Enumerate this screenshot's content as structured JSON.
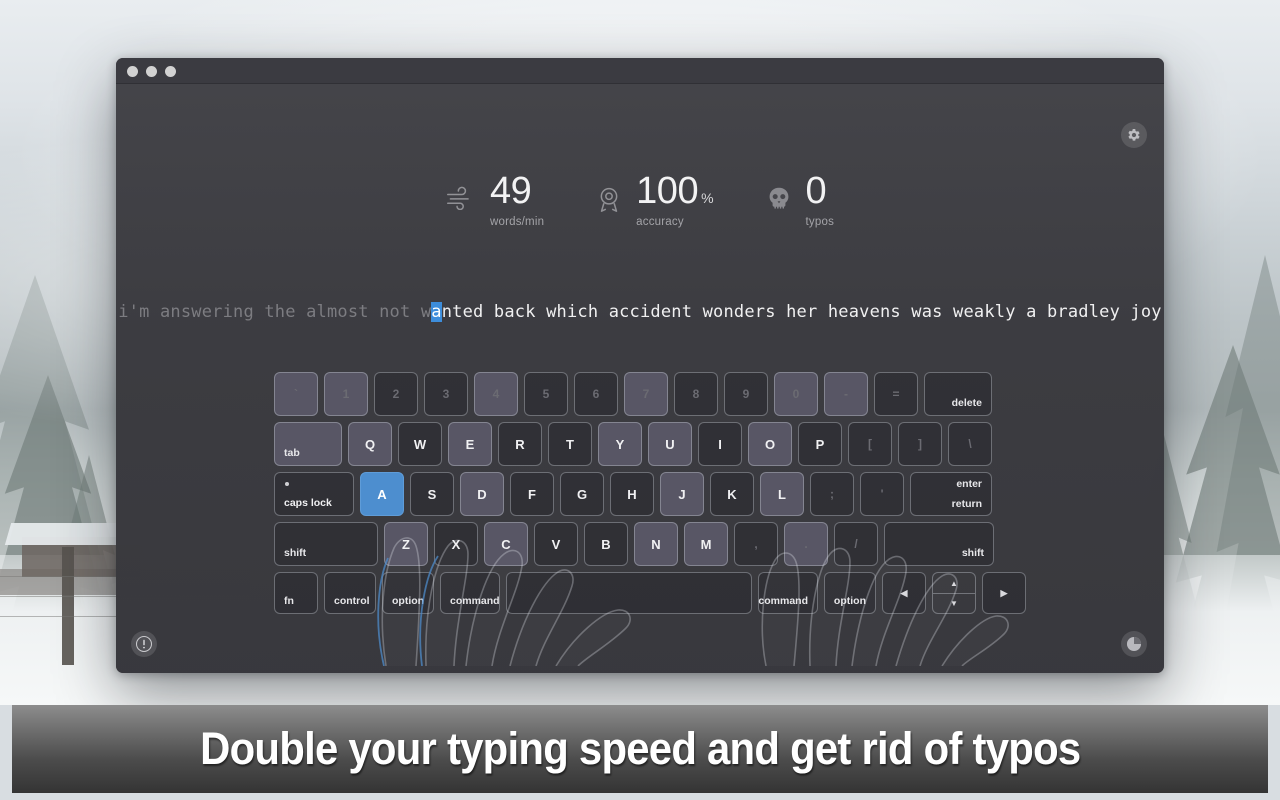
{
  "window": {
    "traffic_lights": [
      "close",
      "minimize",
      "zoom"
    ]
  },
  "icons": {
    "gear": "gear-icon",
    "info": "exclamation-circle-icon",
    "stats": "pie-chart-icon",
    "wind": "wind-icon",
    "medal": "medal-icon",
    "skull": "skull-icon"
  },
  "stats": [
    {
      "value": "49",
      "unit": "",
      "label": "words/min",
      "icon": "wind-icon"
    },
    {
      "value": "100",
      "unit": "%",
      "label": "accuracy",
      "icon": "medal-icon"
    },
    {
      "value": "0",
      "unit": "",
      "label": "typos",
      "icon": "skull-icon"
    }
  ],
  "typing": {
    "typed": "i'm answering the almost not w",
    "cursor": "a",
    "pending": "nted back which accident wonders her heavens was weakly a bradley joy",
    "full_text": "i'm answering the almost not wanted back which accident wonders her heavens was weakly a bradley joy",
    "cursor_color": "#3d8ddb"
  },
  "keyboard": {
    "active_key": "A",
    "rows": [
      {
        "name": "number-row",
        "keys": [
          {
            "label": "`",
            "style": "dim lit",
            "width": "w-mod"
          },
          {
            "label": "1",
            "style": "dim lit",
            "width": "w-mod"
          },
          {
            "label": "2",
            "style": "dim",
            "width": "w-mod"
          },
          {
            "label": "3",
            "style": "dim",
            "width": "w-mod"
          },
          {
            "label": "4",
            "style": "dim lit",
            "width": "w-mod"
          },
          {
            "label": "5",
            "style": "dim",
            "width": "w-mod"
          },
          {
            "label": "6",
            "style": "dim",
            "width": "w-mod"
          },
          {
            "label": "7",
            "style": "dim lit",
            "width": "w-mod"
          },
          {
            "label": "8",
            "style": "dim",
            "width": "w-mod"
          },
          {
            "label": "9",
            "style": "dim",
            "width": "w-mod"
          },
          {
            "label": "0",
            "style": "dim lit",
            "width": "w-mod"
          },
          {
            "label": "-",
            "style": "dim lit",
            "width": "w-mod"
          },
          {
            "label": "=",
            "style": "dim",
            "width": "w-mod"
          },
          {
            "label": "delete",
            "style": "lbl-br",
            "width": "w-del"
          }
        ]
      },
      {
        "name": "top-letter-row",
        "keys": [
          {
            "label": "tab",
            "style": "lbl-bl lit",
            "width": "w-tab"
          },
          {
            "label": "Q",
            "style": "lit",
            "width": "w-mod"
          },
          {
            "label": "W",
            "style": "",
            "width": "w-mod"
          },
          {
            "label": "E",
            "style": "lit",
            "width": "w-mod"
          },
          {
            "label": "R",
            "style": "",
            "width": "w-mod"
          },
          {
            "label": "T",
            "style": "",
            "width": "w-mod"
          },
          {
            "label": "Y",
            "style": "lit",
            "width": "w-mod"
          },
          {
            "label": "U",
            "style": "lit",
            "width": "w-mod"
          },
          {
            "label": "I",
            "style": "",
            "width": "w-mod"
          },
          {
            "label": "O",
            "style": "lit",
            "width": "w-mod"
          },
          {
            "label": "P",
            "style": "",
            "width": "w-mod"
          },
          {
            "label": "[",
            "style": "dim",
            "width": "w-mod"
          },
          {
            "label": "]",
            "style": "dim",
            "width": "w-mod"
          },
          {
            "label": "\\",
            "style": "dim",
            "width": "w-mod"
          }
        ]
      },
      {
        "name": "home-row",
        "keys": [
          {
            "label": "caps lock",
            "style": "capslock",
            "width": "w-caps"
          },
          {
            "label": "A",
            "style": "active",
            "width": "w-mod"
          },
          {
            "label": "S",
            "style": "",
            "width": "w-mod"
          },
          {
            "label": "D",
            "style": "lit",
            "width": "w-mod"
          },
          {
            "label": "F",
            "style": "",
            "width": "w-mod"
          },
          {
            "label": "G",
            "style": "",
            "width": "w-mod"
          },
          {
            "label": "H",
            "style": "",
            "width": "w-mod"
          },
          {
            "label": "J",
            "style": "lit",
            "width": "w-mod"
          },
          {
            "label": "K",
            "style": "",
            "width": "w-mod"
          },
          {
            "label": "L",
            "style": "lit",
            "width": "w-mod"
          },
          {
            "label": ";",
            "style": "dim",
            "width": "w-mod"
          },
          {
            "label": "'",
            "style": "dim",
            "width": "w-mod"
          },
          {
            "label": "enter|return",
            "style": "enter",
            "width": "w-enter"
          }
        ]
      },
      {
        "name": "bottom-letter-row",
        "keys": [
          {
            "label": "shift",
            "style": "lbl-bl",
            "width": "w-shiftl"
          },
          {
            "label": "Z",
            "style": "lit",
            "width": "w-mod"
          },
          {
            "label": "X",
            "style": "",
            "width": "w-mod"
          },
          {
            "label": "C",
            "style": "lit",
            "width": "w-mod"
          },
          {
            "label": "V",
            "style": "",
            "width": "w-mod"
          },
          {
            "label": "B",
            "style": "",
            "width": "w-mod"
          },
          {
            "label": "N",
            "style": "lit",
            "width": "w-mod"
          },
          {
            "label": "M",
            "style": "lit",
            "width": "w-mod"
          },
          {
            "label": ",",
            "style": "dim",
            "width": "w-mod"
          },
          {
            "label": ".",
            "style": "dim lit",
            "width": "w-mod"
          },
          {
            "label": "/",
            "style": "dim",
            "width": "w-mod"
          },
          {
            "label": "shift",
            "style": "lbl-br",
            "width": "w-shiftr"
          }
        ]
      },
      {
        "name": "modifier-row",
        "keys": [
          {
            "label": "fn",
            "style": "lbl-bl",
            "width": "w-mod"
          },
          {
            "label": "control",
            "style": "lbl-bl",
            "width": "w-mod2"
          },
          {
            "label": "option",
            "style": "lbl-bl",
            "width": "w-mod2"
          },
          {
            "label": "command",
            "style": "lbl-bl",
            "width": "w-cmd"
          },
          {
            "label": "",
            "style": "",
            "width": "w-space"
          },
          {
            "label": "command",
            "style": "lbl-br",
            "width": "w-cmd"
          },
          {
            "label": "option",
            "style": "lbl-br",
            "width": "w-mod2"
          },
          {
            "label": "◀",
            "style": "arrow-key",
            "width": "w-mod"
          },
          {
            "label": "▲|▼",
            "style": "arrow-split",
            "width": "w-mod"
          },
          {
            "label": "▶",
            "style": "arrow-key",
            "width": "w-mod"
          }
        ]
      }
    ]
  },
  "caption": {
    "text": "Double your typing speed and get rid of typos"
  }
}
